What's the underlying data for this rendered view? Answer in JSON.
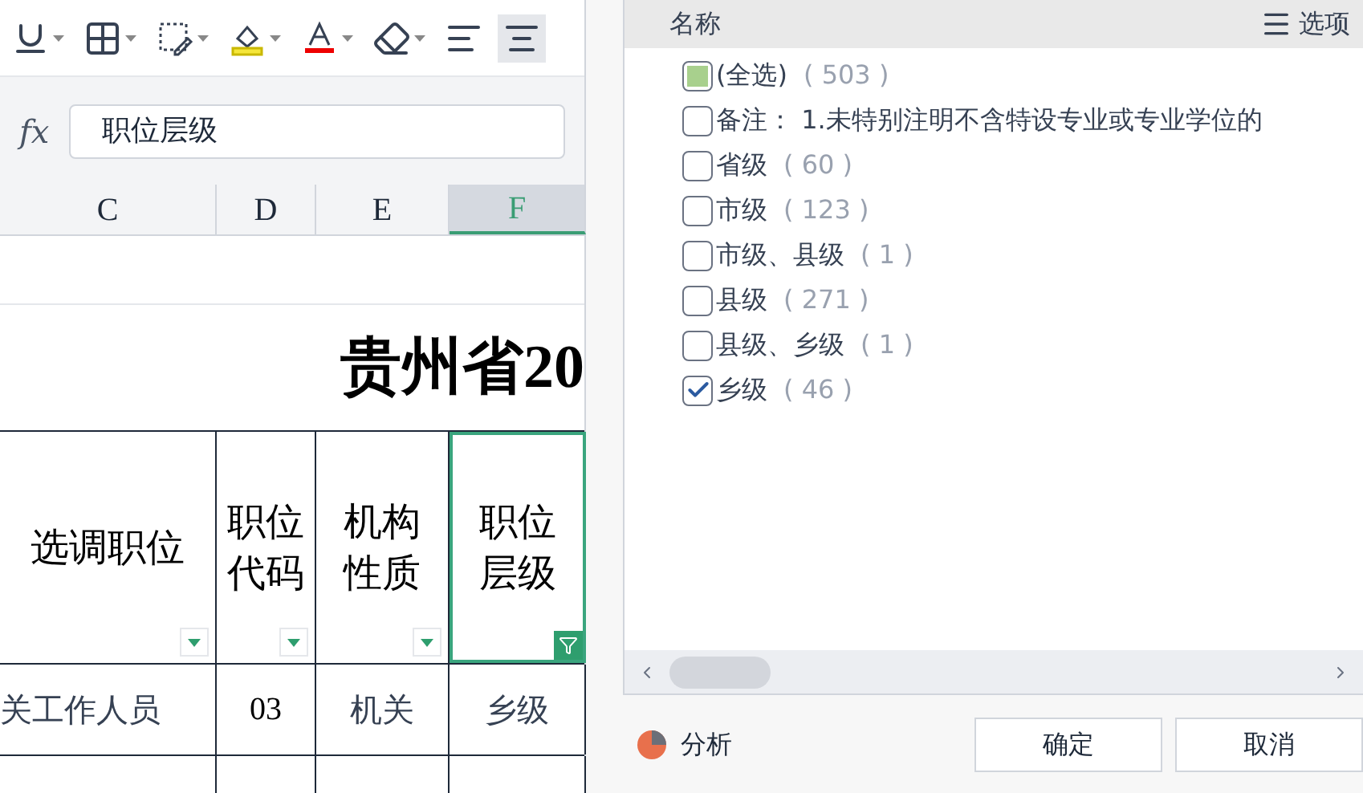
{
  "toolbar": {
    "buttons": [
      {
        "kind": "underline",
        "selected": false
      },
      {
        "kind": "borders",
        "selected": false
      },
      {
        "kind": "format",
        "selected": false
      },
      {
        "kind": "fill",
        "selected": false
      },
      {
        "kind": "font-color",
        "selected": false
      },
      {
        "kind": "eraser",
        "selected": false
      },
      {
        "kind": "align-left",
        "selected": false
      },
      {
        "kind": "align-center",
        "selected": true
      }
    ]
  },
  "formula_bar": {
    "fx": "fx",
    "value": "职位层级"
  },
  "columns": [
    {
      "label": "C",
      "selected": false
    },
    {
      "label": "D",
      "selected": false
    },
    {
      "label": "E",
      "selected": false
    },
    {
      "label": "F",
      "selected": true
    }
  ],
  "sheet": {
    "title": "贵州省20",
    "header": [
      {
        "text": "选调职位",
        "filtered": false
      },
      {
        "text": "职位代码",
        "filtered": false
      },
      {
        "text": "机构性质",
        "filtered": false
      },
      {
        "text": "职位层级",
        "filtered": true
      }
    ],
    "rows": [
      [
        "关工作人员",
        "03",
        "机关",
        "乡级"
      ]
    ]
  },
  "filter_panel": {
    "column_title": "名称",
    "options_button": "选项",
    "items": [
      {
        "label": "(全选)",
        "count": "( 503 )",
        "checked": false,
        "indeterminate": true
      },
      {
        "label": "备注： 1.未特别注明不含特设专业或专业学位的",
        "checked": false,
        "indeterminate": false
      },
      {
        "label": "省级",
        "count": "( 60 )",
        "checked": false,
        "indeterminate": false
      },
      {
        "label": "市级",
        "count": "( 123 )",
        "checked": false,
        "indeterminate": false
      },
      {
        "label": "市级、县级",
        "count": "( 1 )",
        "checked": false,
        "indeterminate": false
      },
      {
        "label": "县级",
        "count": "( 271 )",
        "checked": false,
        "indeterminate": false
      },
      {
        "label": "县级、乡级",
        "count": "( 1 )",
        "checked": false,
        "indeterminate": false
      },
      {
        "label": "乡级",
        "count": "( 46 )",
        "checked": true,
        "indeterminate": false
      }
    ],
    "analysis": "分析",
    "buttons": [
      "确定",
      "取消"
    ]
  }
}
